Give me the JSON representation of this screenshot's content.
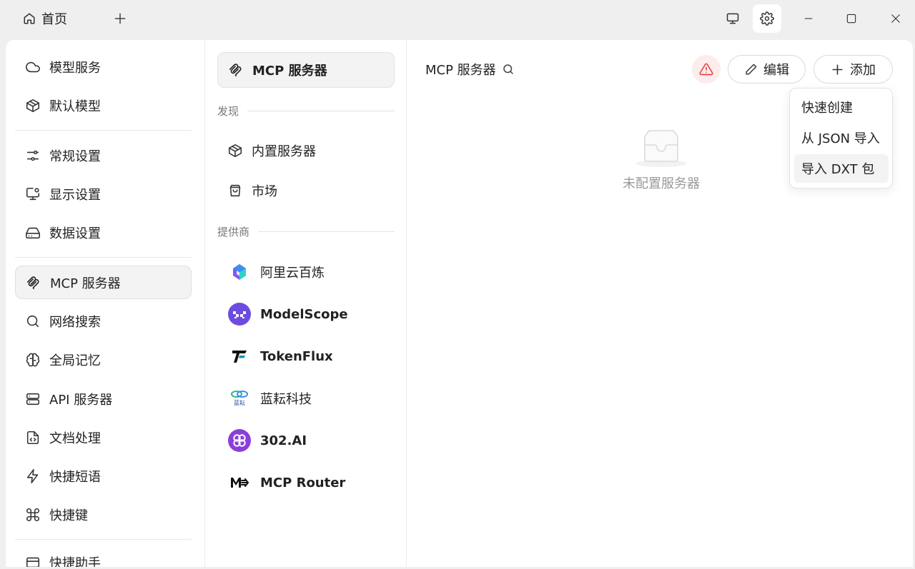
{
  "titlebar": {
    "home_tab": "首页"
  },
  "sidebar": {
    "items": [
      {
        "label": "模型服务",
        "icon": "cloud-icon"
      },
      {
        "label": "默认模型",
        "icon": "package-icon"
      },
      {
        "label": "常规设置",
        "icon": "sliders-icon"
      },
      {
        "label": "显示设置",
        "icon": "monitor-settings-icon"
      },
      {
        "label": "数据设置",
        "icon": "hard-drive-icon"
      },
      {
        "label": "MCP 服务器",
        "icon": "mcp-icon",
        "active": true
      },
      {
        "label": "网络搜索",
        "icon": "search-icon"
      },
      {
        "label": "全局记忆",
        "icon": "brain-icon"
      },
      {
        "label": "API 服务器",
        "icon": "server-icon"
      },
      {
        "label": "文档处理",
        "icon": "file-code-icon"
      },
      {
        "label": "快捷短语",
        "icon": "zap-icon"
      },
      {
        "label": "快捷键",
        "icon": "command-icon"
      },
      {
        "label": "快捷助手",
        "icon": "assistant-icon"
      }
    ]
  },
  "mcp_nav": {
    "active": "MCP 服务器",
    "discover_label": "发现",
    "discover_items": [
      "内置服务器",
      "市场"
    ],
    "providers_label": "提供商",
    "providers": [
      "阿里云百炼",
      "ModelScope",
      "TokenFlux",
      "蓝耘科技",
      "302.AI",
      "MCP Router"
    ],
    "lanyun_logo_text": "蓝耘"
  },
  "content": {
    "title": "MCP 服务器",
    "edit_label": "编辑",
    "add_label": "添加",
    "empty_text": "未配置服务器"
  },
  "add_menu": {
    "items": [
      "快速创建",
      "从 JSON 导入",
      "导入 DXT 包"
    ]
  },
  "colors": {
    "warning": "#e5484d",
    "modelscope": "#6c4ce0",
    "ai302": "#8b3fd9",
    "tokenflux": "#0d9aa8"
  }
}
